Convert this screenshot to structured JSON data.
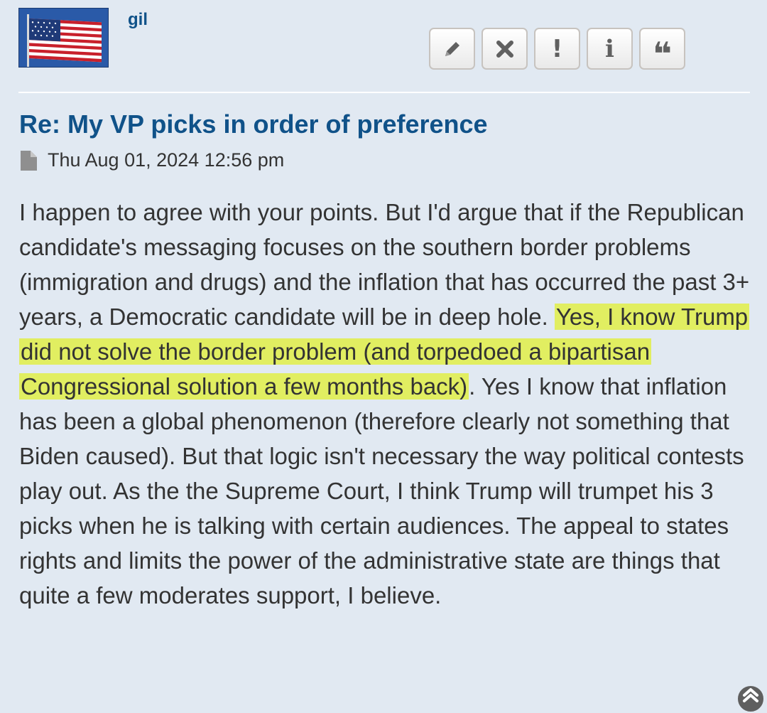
{
  "post": {
    "author": "gil",
    "title": "Re: My VP picks in order of preference",
    "timestamp": "Thu Aug 01, 2024 12:56 pm",
    "body_before": "I happen to agree with your points. But I'd argue that if the Republican candidate's messaging focuses on the southern border problems (immigration and drugs) and the inflation that has occurred the past 3+ years, a Democratic candidate will be in deep hole. ",
    "body_highlight": "Yes, I know Trump did not solve the border problem (and torpedoed a bipartisan Congressional solution a few months back)",
    "body_after": ". Yes I know that inflation has been a global phenomenon (therefore clearly not something that Biden caused). But that logic isn't necessary the way political contests play out. As the the Supreme Court, I think Trump will trumpet his 3 picks when he is talking with certain audiences. The appeal to states rights and limits the power of the administrative state are things that quite a few moderates support, I believe."
  },
  "post_buttons": {
    "edit_icon": "pencil-icon",
    "delete_icon": "times-icon",
    "report_label": "!",
    "info_label": "i",
    "quote_label": "❝"
  },
  "icons": {
    "avatar": "us-flag",
    "meta": "file-icon",
    "scroll": "chevron-up-circle-icon"
  },
  "colors": {
    "background": "#e1e9f2",
    "link": "#105289",
    "text": "#333333",
    "highlight": "#e1f028"
  }
}
